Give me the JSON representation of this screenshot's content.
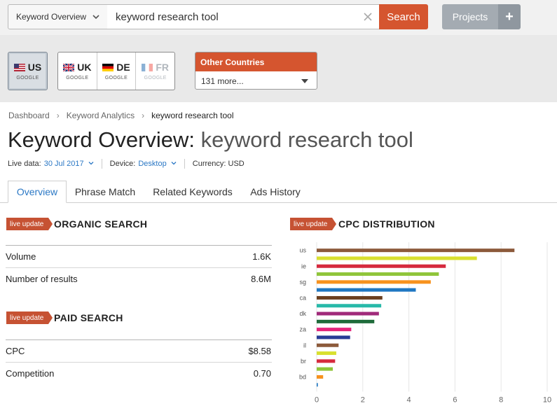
{
  "search": {
    "database_label": "Keyword Overview",
    "query": "keyword research tool",
    "button_label": "Search"
  },
  "projects": {
    "label": "Projects",
    "add_symbol": "+"
  },
  "countries": {
    "active": {
      "code": "US",
      "engine": "GOOGLE"
    },
    "group": [
      {
        "code": "UK",
        "engine": "GOOGLE"
      },
      {
        "code": "DE",
        "engine": "GOOGLE"
      },
      {
        "code": "FR",
        "engine": "GOOGLE"
      }
    ],
    "other_title": "Other Countries",
    "other_value": "131 more..."
  },
  "breadcrumb": [
    "Dashboard",
    "Keyword Analytics",
    "keyword research tool"
  ],
  "page_title": {
    "prefix": "Keyword Overview:",
    "keyword": "keyword research tool"
  },
  "meta": {
    "live_label": "Live data:",
    "live_date": "30 Jul 2017",
    "device_label": "Device:",
    "device_value": "Desktop",
    "currency": "Currency: USD"
  },
  "tabs": [
    "Overview",
    "Phrase Match",
    "Related Keywords",
    "Ads History"
  ],
  "badge_label": "live update",
  "organic": {
    "title": "ORGANIC SEARCH",
    "rows": [
      {
        "label": "Volume",
        "value": "1.6K"
      },
      {
        "label": "Number of results",
        "value": "8.6M"
      }
    ]
  },
  "paid": {
    "title": "PAID SEARCH",
    "rows": [
      {
        "label": "CPC",
        "value": "$8.58"
      },
      {
        "label": "Competition",
        "value": "0.70"
      }
    ]
  },
  "chart_data": {
    "type": "bar",
    "orientation": "horizontal",
    "title": "CPC DISTRIBUTION",
    "category_labels": [
      "us",
      "",
      "ie",
      "",
      "sg",
      "",
      "ca",
      "",
      "dk",
      "",
      "za",
      "",
      "il",
      "",
      "br",
      "",
      "bd",
      ""
    ],
    "values": [
      8.58,
      6.95,
      5.6,
      5.3,
      4.95,
      4.3,
      2.85,
      2.8,
      2.7,
      2.5,
      1.5,
      1.45,
      0.95,
      0.85,
      0.8,
      0.7,
      0.28,
      0.05
    ],
    "colors": [
      "#8c5a3b",
      "#d9e02f",
      "#d62a3e",
      "#8fc53a",
      "#f7921e",
      "#1f77c2",
      "#6b3f1f",
      "#28b9a9",
      "#a02a7a",
      "#1e6b3a",
      "#e2247a",
      "#283c96",
      "#8c5a3b",
      "#d9e02f",
      "#d62a3e",
      "#8fc53a",
      "#f7921e",
      "#1f77c2"
    ],
    "xlim": [
      0,
      10
    ],
    "xticks": [
      0,
      2,
      4,
      6,
      8,
      10
    ],
    "grid": true
  }
}
